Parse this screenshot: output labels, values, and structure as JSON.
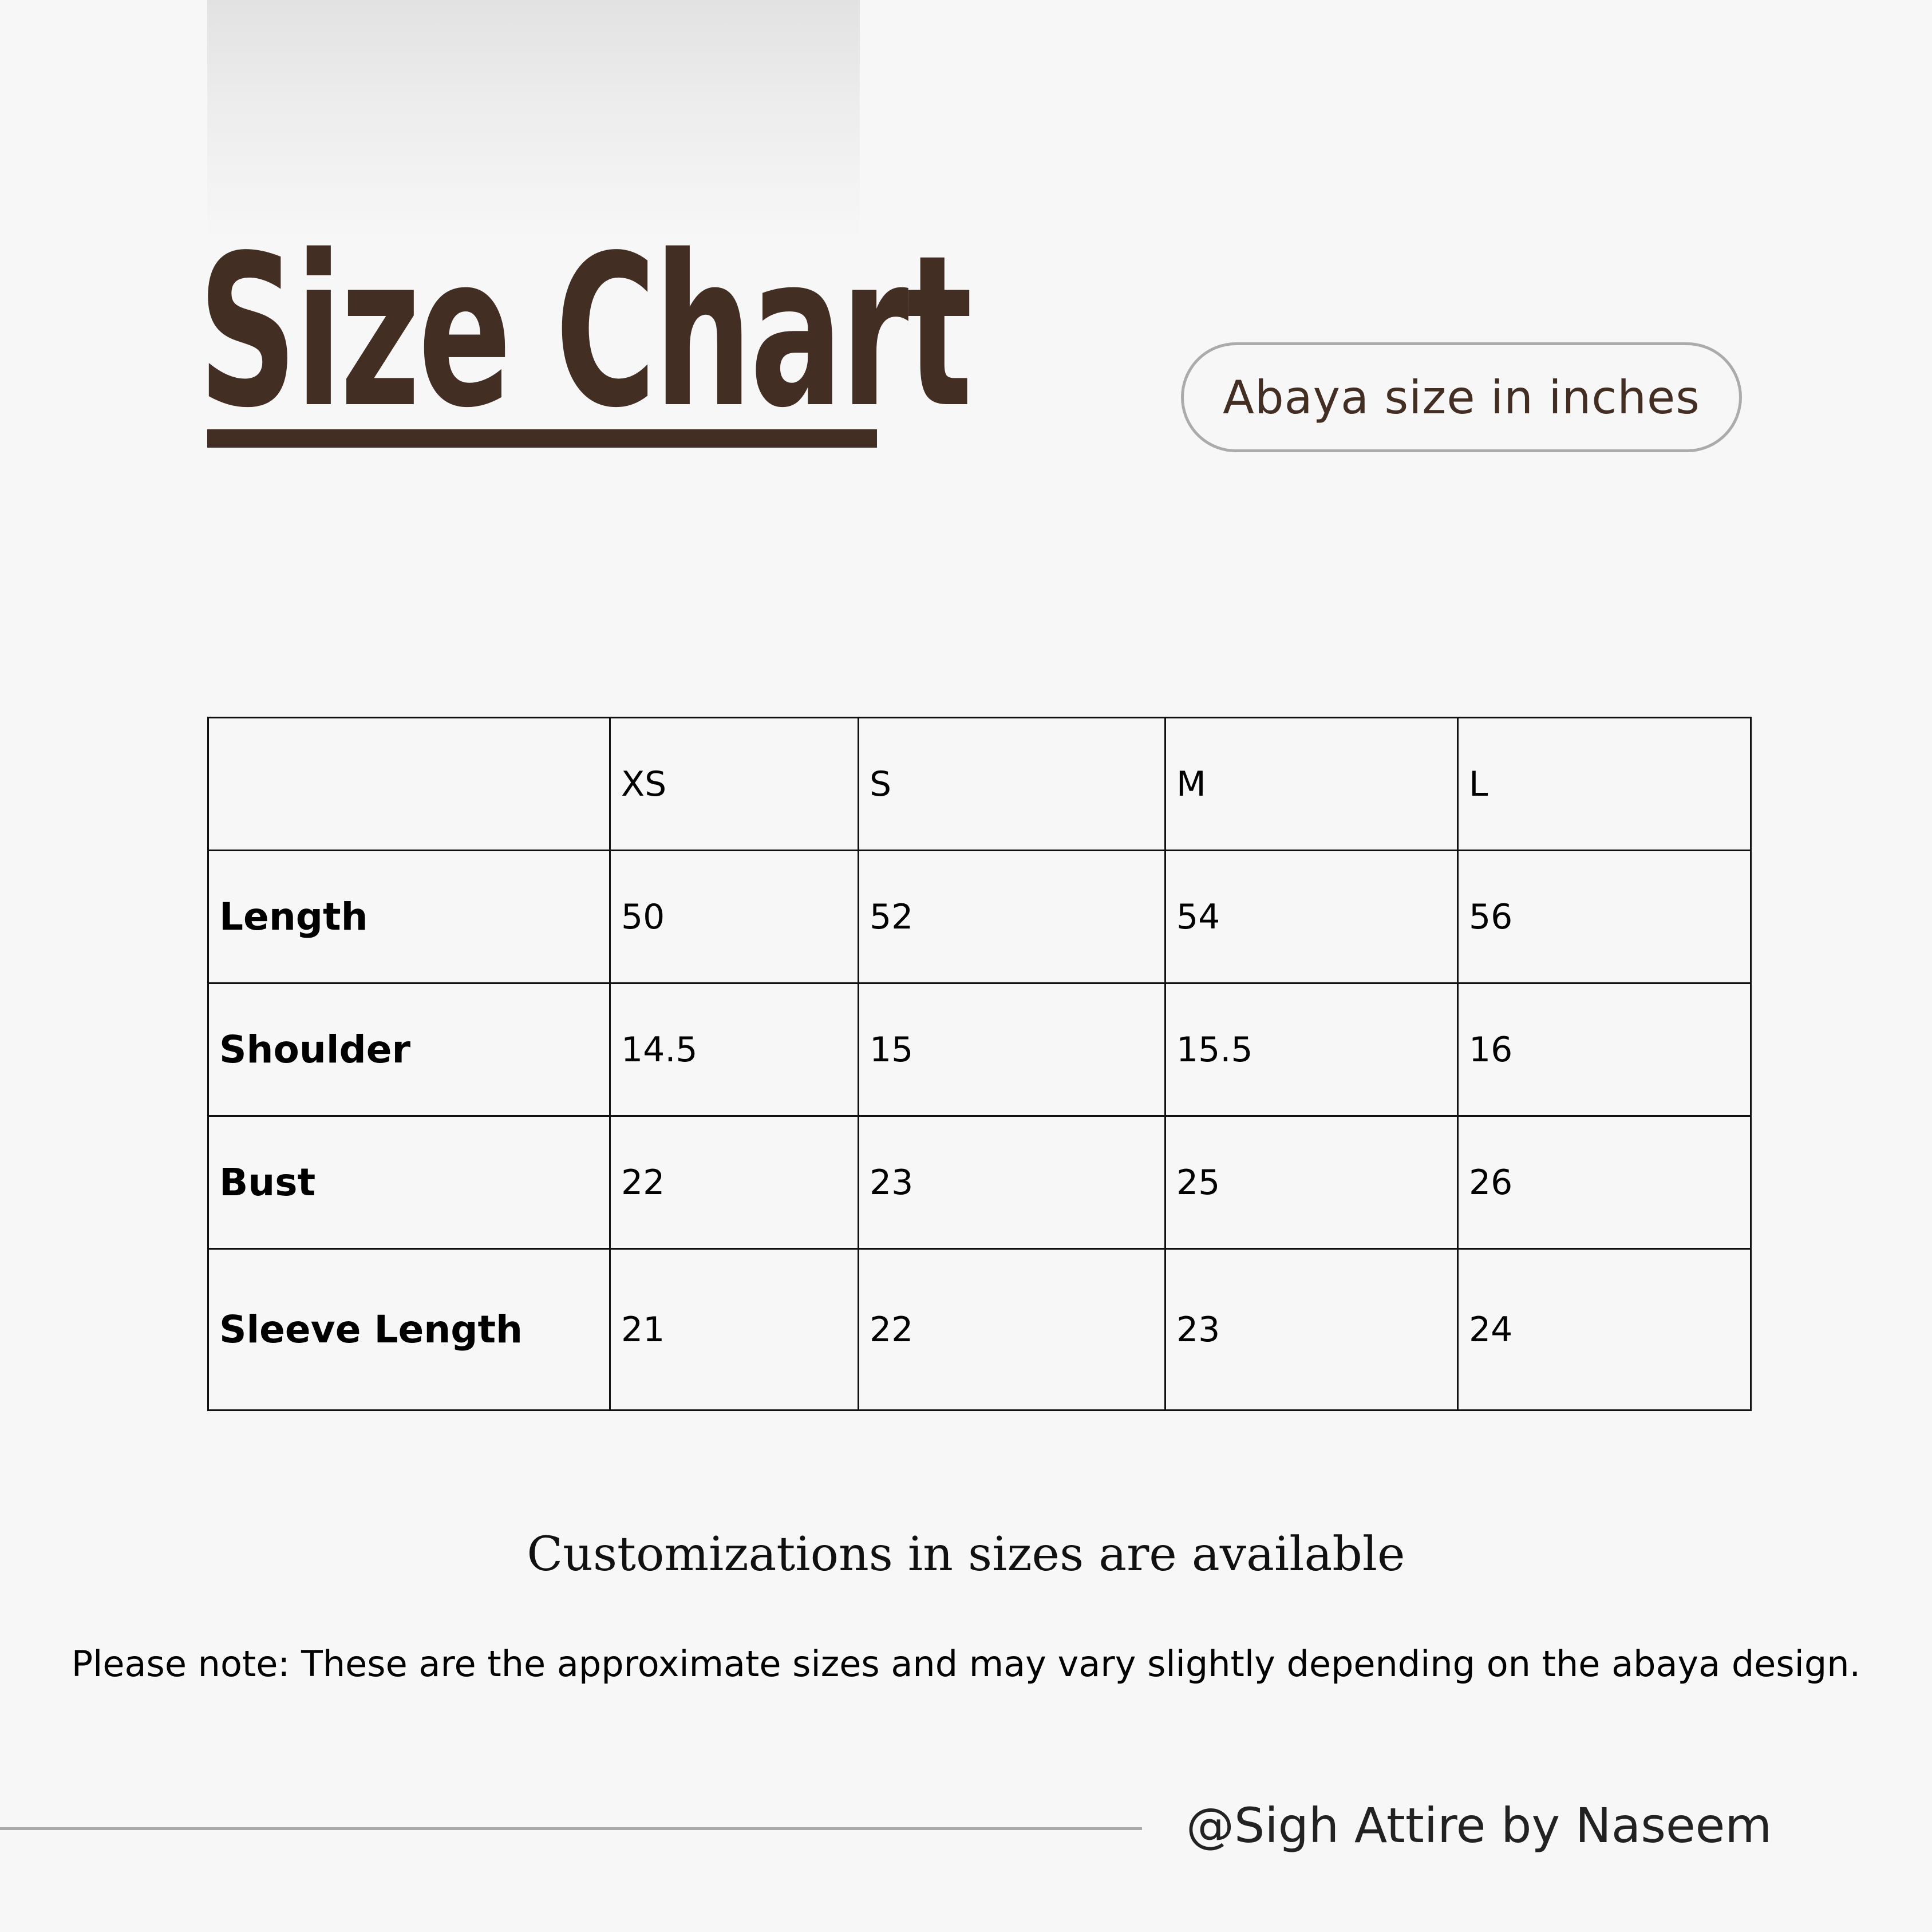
{
  "title": "Size Chart",
  "unit_label": "Abaya size in inches",
  "table": {
    "columns": [
      "",
      "XS",
      "S",
      "M",
      "L"
    ],
    "rows": [
      {
        "label": "Length",
        "values": [
          "50",
          "52",
          "54",
          "56"
        ]
      },
      {
        "label": "Shoulder",
        "values": [
          "14.5",
          "15",
          "15.5",
          "16"
        ]
      },
      {
        "label": "Bust",
        "values": [
          "22",
          "23",
          "25",
          "26"
        ]
      },
      {
        "label": "Sleeve Length",
        "values": [
          "21",
          "22",
          "23",
          "24"
        ]
      }
    ]
  },
  "customization_note": "Customizations in sizes are available",
  "disclaimer": "Please note: These are the approximate sizes and may vary slightly depending on the abaya design.",
  "brand": "@Sigh Attire by Naseem",
  "colors": {
    "background": "#f7f7f7",
    "accent_brown": "#432e23",
    "pill_border": "#ababab",
    "footer_line": "#a9a9a9"
  }
}
